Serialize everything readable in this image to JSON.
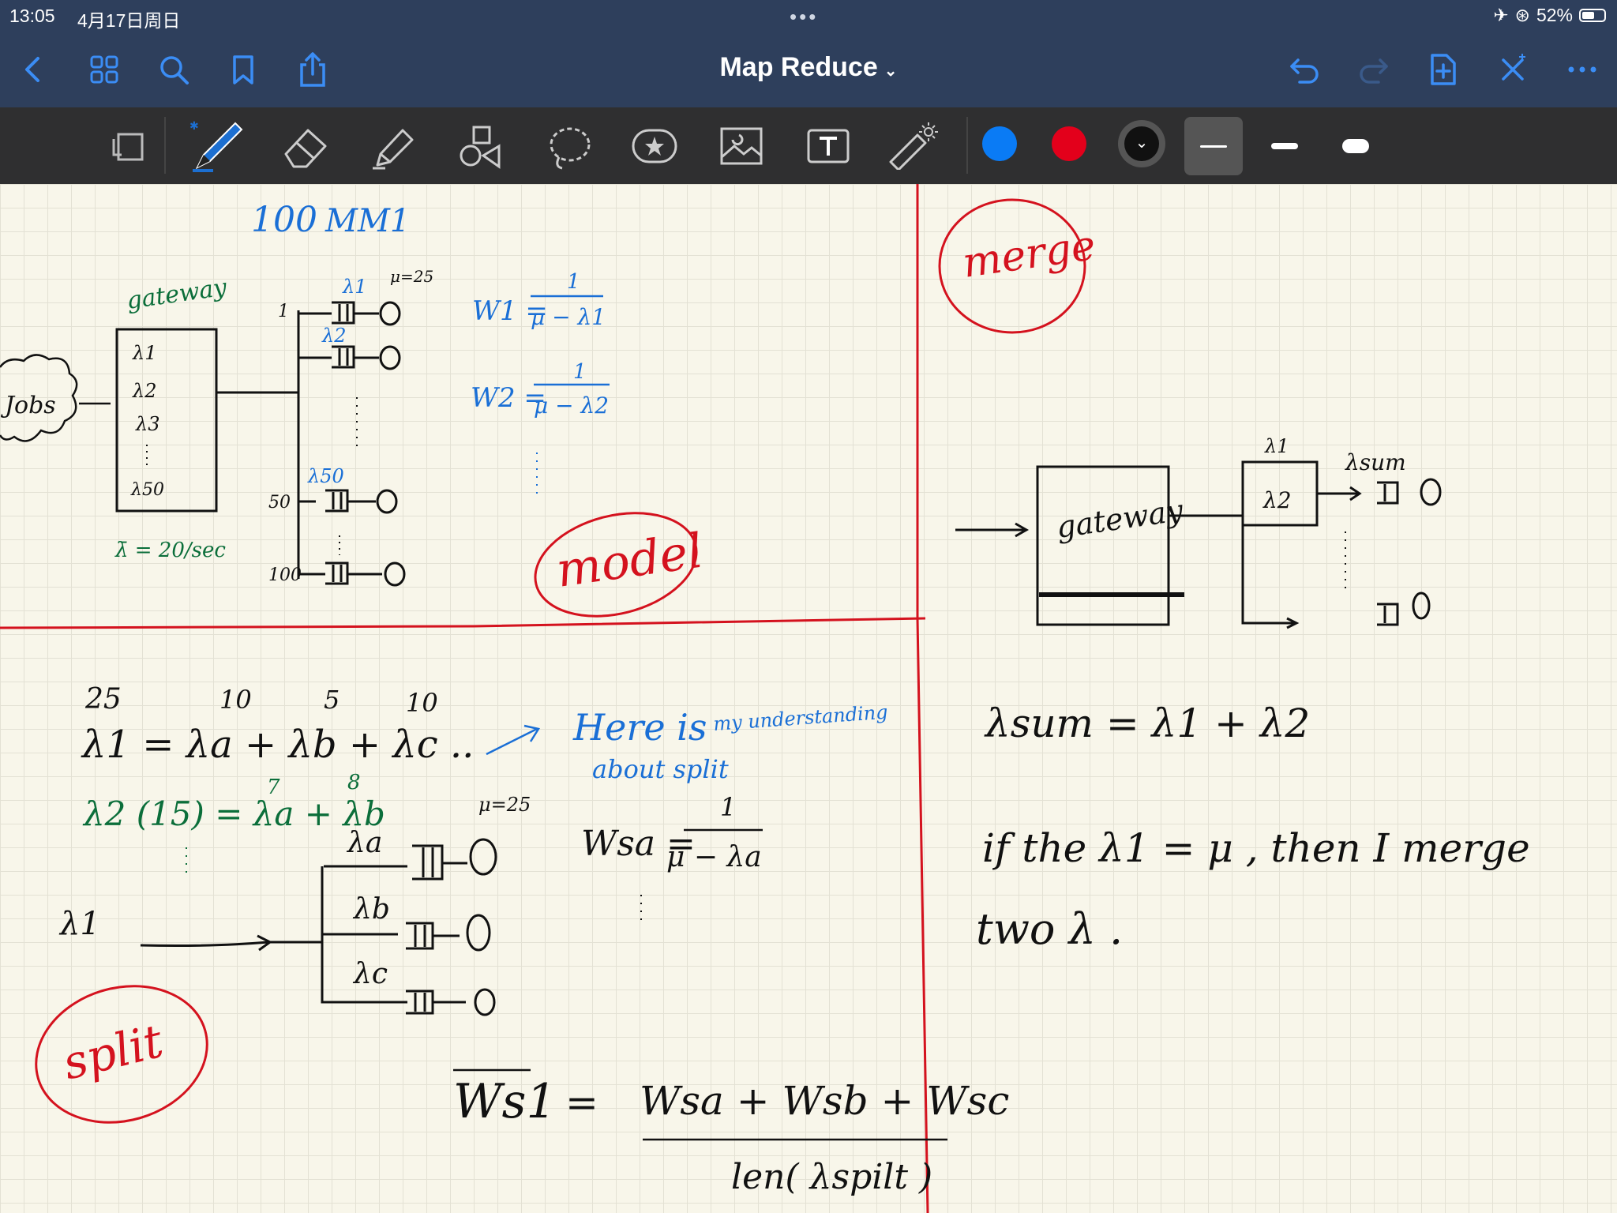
{
  "status": {
    "time": "13:05",
    "date": "4月17日周日",
    "battery": "52%",
    "battery_level": 0.52
  },
  "nav": {
    "title": "Map Reduce"
  },
  "toolbar": {
    "colors": [
      "#0a7bf5",
      "#e3001b",
      "#111111"
    ]
  },
  "notes": {
    "top_left": {
      "heading_100": "100",
      "heading_mm1": "MM1",
      "gateway": "gateway",
      "jobs": "Jobs",
      "l1": "λ1",
      "l2": "λ2",
      "l3": "λ3",
      "l50": "λ50",
      "lam_label_1": "λ1",
      "mu": "μ=25",
      "lam_label_2": "λ2",
      "lam_label_50": "λ50",
      "idx_1": "1",
      "idx_50": "50",
      "idx_100": "100",
      "lambda_bar": "λ̄ = 20/sec",
      "w1": "W1 =",
      "w1_num": "1",
      "w1_den": "μ − λ1",
      "w2": "W2 =",
      "w2_num": "1",
      "w2_den": "μ − λ2",
      "model": "model"
    },
    "top_right": {
      "merge": "merge",
      "gateway": "gateway",
      "l1": "λ1",
      "l2": "λ2",
      "lsum": "λsum"
    },
    "bottom_left": {
      "n25": "25",
      "n10a": "10",
      "n5": "5",
      "n10b": "10",
      "eq1": "λ1 =   λa  +  λb +  λc ..",
      "here": "Here is",
      "understanding": "my understanding",
      "about": "about split",
      "n7": "7",
      "n8": "8",
      "eq2": "λ2 (15) =  λa  + λb",
      "mu": "μ=25",
      "la": "λa",
      "lb": "λb",
      "lc": "λc",
      "l1": "λ1",
      "wsa": "Wsa =",
      "wsa_num": "1",
      "wsa_den": "μ − λa",
      "split": "split",
      "ws1": "Ws1",
      "eq": "=",
      "num": "Wsa + Wsb + Wsc",
      "den": "len( λspilt )"
    },
    "bottom_right": {
      "lsum_eq": "λsum =  λ1 + λ2",
      "line1": "if  the  λ1 = μ ,  then   I   merge",
      "line2": "two  λ ."
    }
  }
}
